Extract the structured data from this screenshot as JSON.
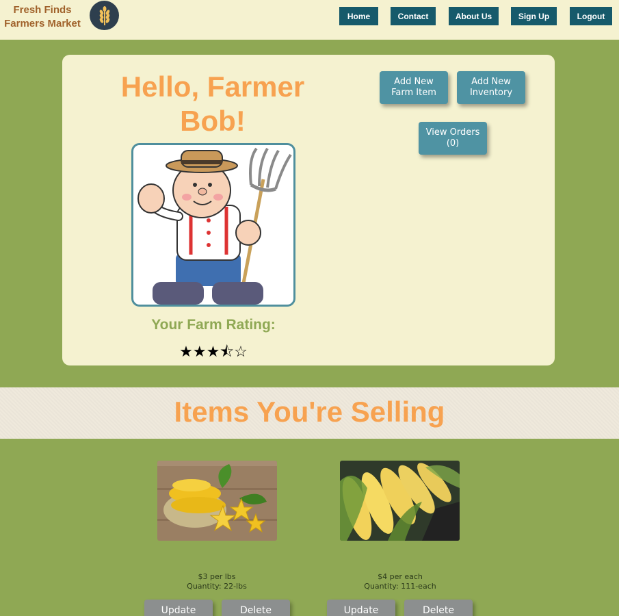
{
  "header": {
    "brand_line1": "Fresh Finds",
    "brand_line2": "Farmers Market",
    "nav": [
      "Home",
      "Contact",
      "About Us",
      "Sign Up",
      "Logout"
    ]
  },
  "profile": {
    "greeting_line1": "Hello, Farmer",
    "greeting_line2": "Bob!",
    "rating_label": "Your Farm Rating:",
    "rating_value": 3.5,
    "rating_max": 5,
    "stars_text": "★★★⯪☆"
  },
  "actions": {
    "add_farm_item": "Add New\nFarm Item",
    "add_inventory": "Add New\nInventory",
    "view_orders": "View Orders\n(0)"
  },
  "section": {
    "title": "Items You're Selling"
  },
  "items": [
    {
      "price": "$3 per lbs",
      "quantity": "Quantity: 22-lbs",
      "update": "Update",
      "delete": "Delete"
    },
    {
      "price": "$4 per each",
      "quantity": "Quantity: 111-each",
      "update": "Update",
      "delete": "Delete"
    }
  ],
  "colors": {
    "accent_orange": "#f7a250",
    "nav_teal": "#165a6b",
    "action_teal": "#4f93a3",
    "page_green": "#8fa854",
    "cream": "#f5f2d0"
  }
}
